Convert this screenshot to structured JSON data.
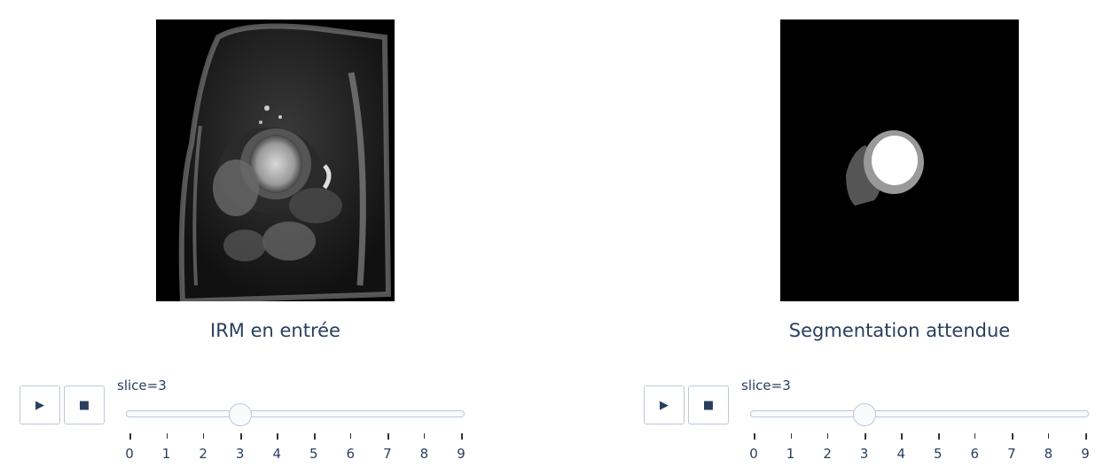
{
  "panels": [
    {
      "caption": "IRM en entrée"
    },
    {
      "caption": "Segmentation attendue"
    }
  ],
  "sliders": [
    {
      "label": "slice=3",
      "value": 3,
      "min": 0,
      "max": 9,
      "ticks": [
        "0",
        "1",
        "2",
        "3",
        "4",
        "5",
        "6",
        "7",
        "8",
        "9"
      ],
      "play_icon": "play-icon",
      "stop_icon": "stop-icon"
    },
    {
      "label": "slice=3",
      "value": 3,
      "min": 0,
      "max": 9,
      "ticks": [
        "0",
        "1",
        "2",
        "3",
        "4",
        "5",
        "6",
        "7",
        "8",
        "9"
      ],
      "play_icon": "play-icon",
      "stop_icon": "stop-icon"
    }
  ],
  "colors": {
    "text": "#2a3f5f",
    "slider_border": "#bec8d9",
    "slider_fill": "#f8fafc"
  }
}
